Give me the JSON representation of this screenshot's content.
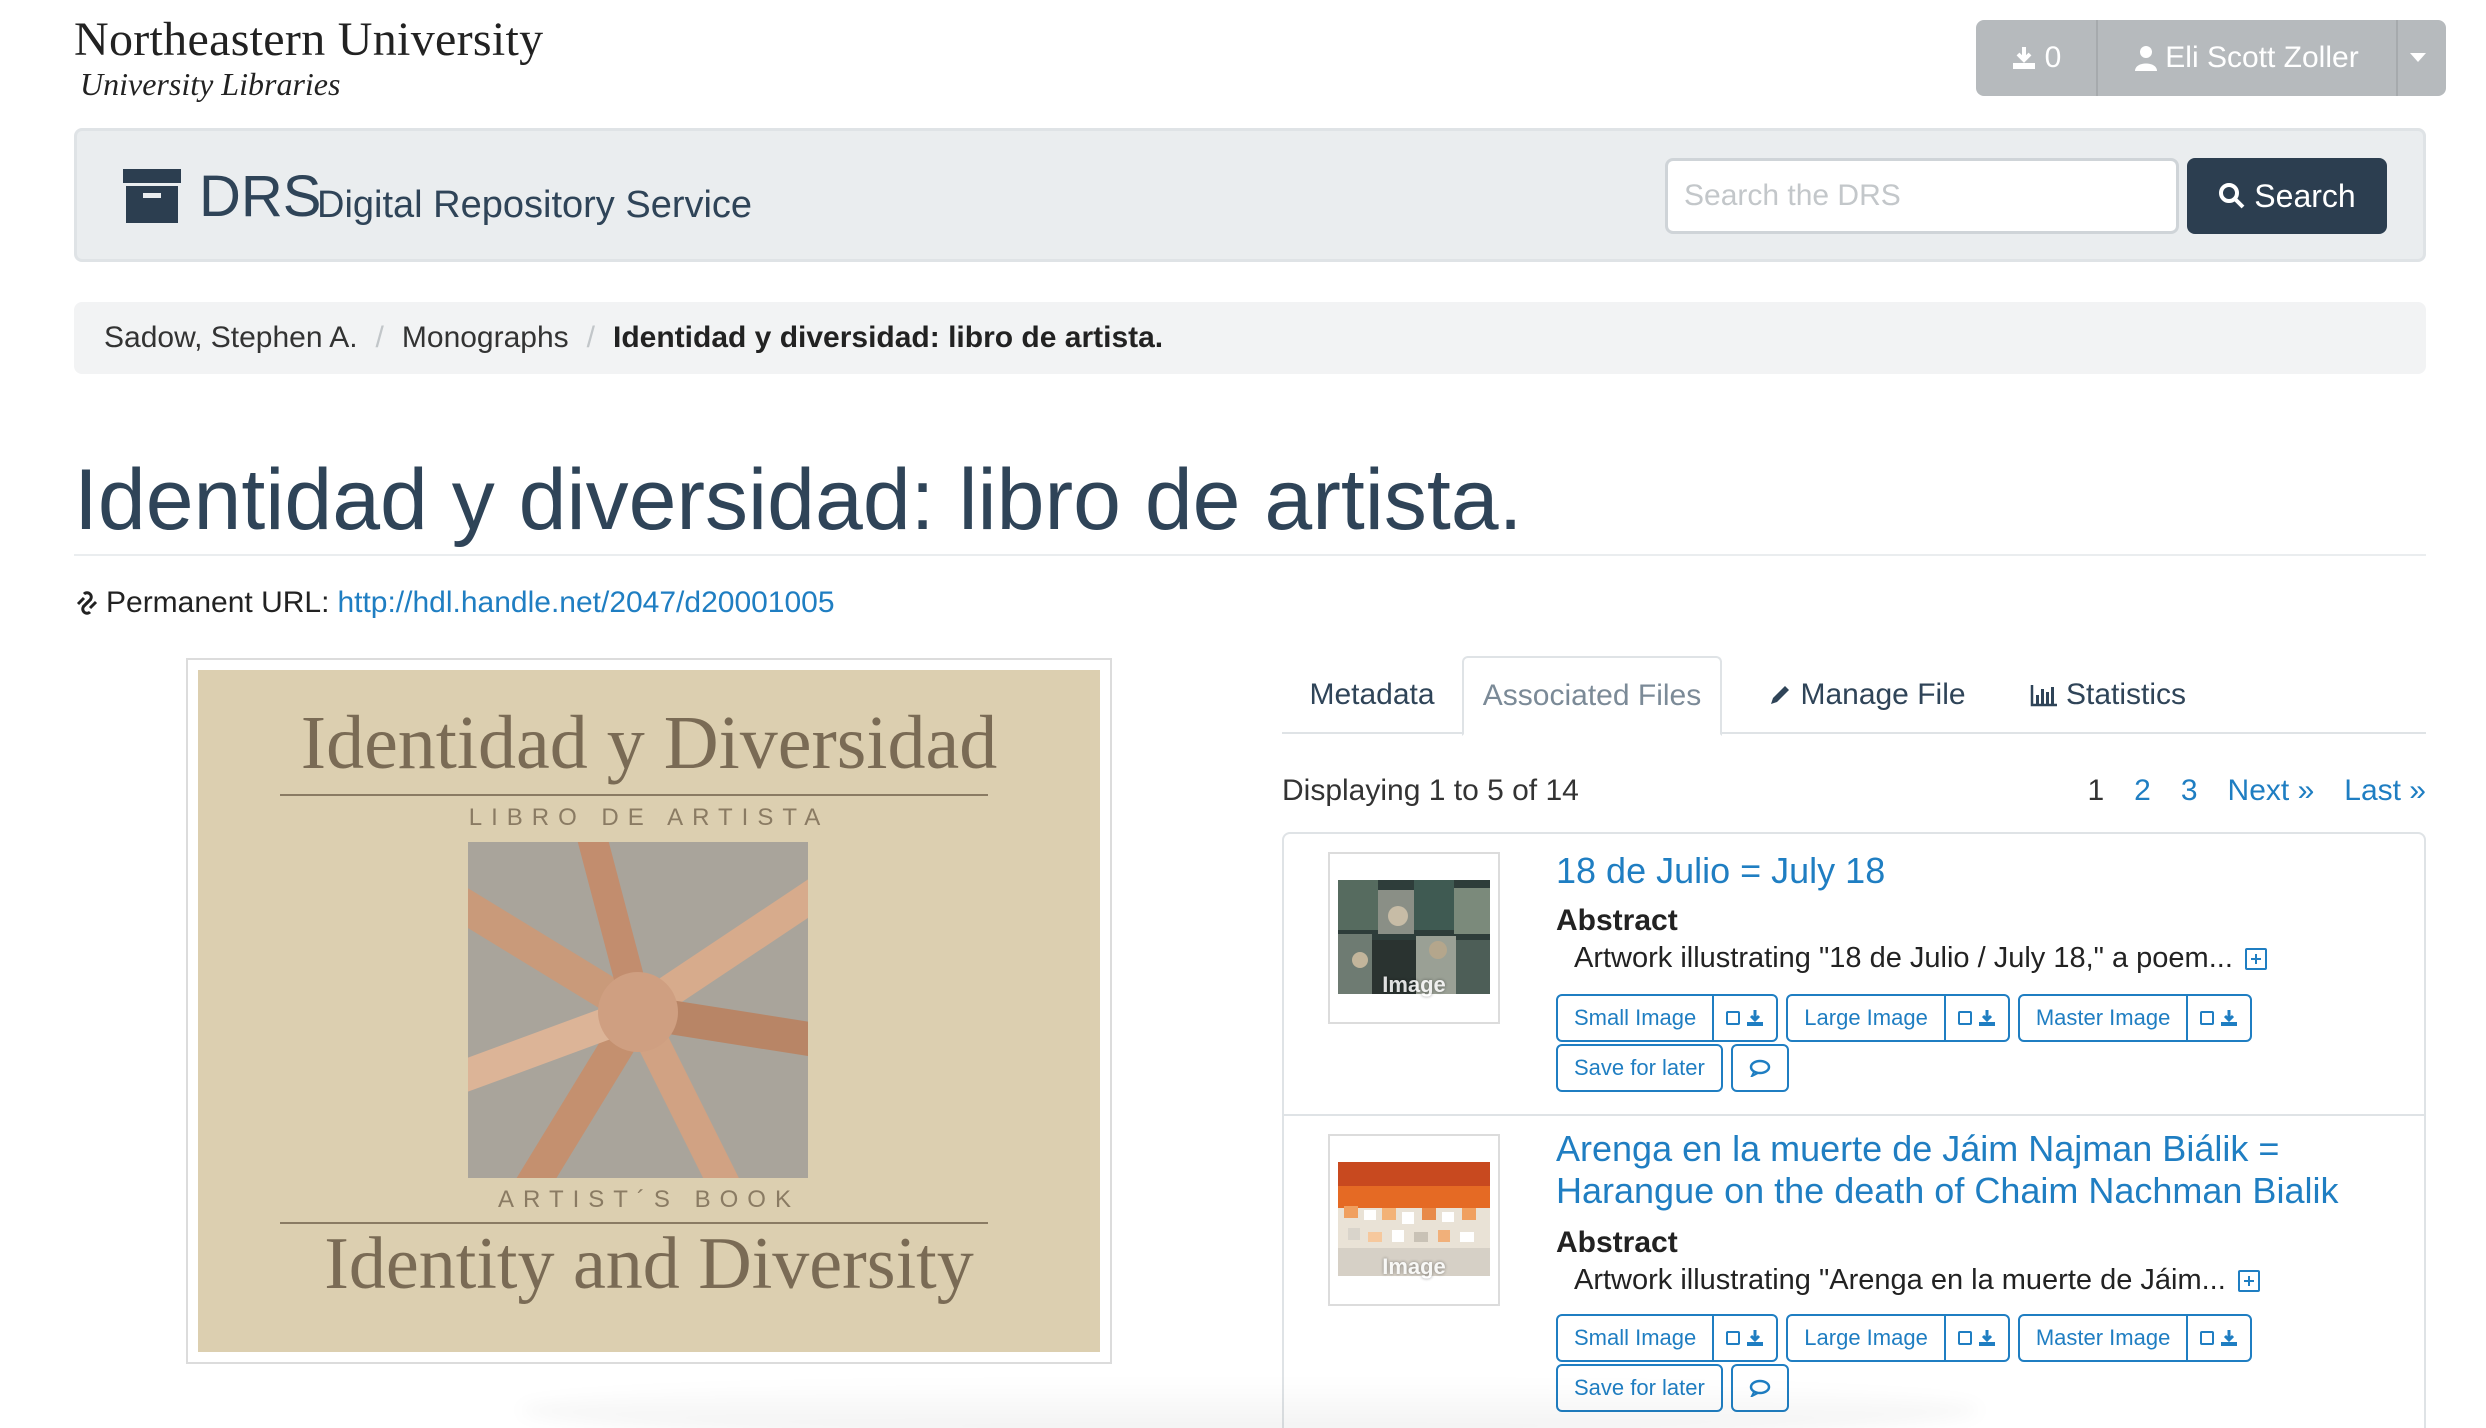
{
  "logo": {
    "line1": "Northeastern University",
    "line2": "University Libraries"
  },
  "user_menu": {
    "download_count": "0",
    "user_name": "Eli Scott Zoller"
  },
  "drs": {
    "acronym": "DRS",
    "full_name": "Digital Repository Service",
    "search_placeholder": "Search the DRS",
    "search_button": "Search"
  },
  "breadcrumb": {
    "items": [
      "Sadow, Stephen A.",
      "Monographs"
    ],
    "current": "Identidad y diversidad: libro de artista."
  },
  "page": {
    "title": "Identidad y diversidad: libro de artista.",
    "permanent_url_label": "Permanent URL:",
    "permanent_url": "http://hdl.handle.net/2047/d20001005"
  },
  "cover": {
    "title_es": "Identidad y Diversidad",
    "subtitle_es": "LIBRO DE ARTISTA",
    "subtitle_en": "ARTIST´S BOOK",
    "title_en": "Identity and Diversity"
  },
  "tabs": [
    {
      "label": "Metadata"
    },
    {
      "label": "Associated Files"
    },
    {
      "label": "Manage File"
    },
    {
      "label": "Statistics"
    }
  ],
  "listing": {
    "displaying": "Displaying 1 to 5 of 14",
    "pagination": {
      "current": "1",
      "pages": [
        "2",
        "3"
      ],
      "next": "Next »",
      "last": "Last »"
    }
  },
  "results": [
    {
      "title": "18 de Julio = July 18",
      "thumb_label": "Image",
      "abstract_label": "Abstract",
      "abstract": "Artwork illustrating \"18 de Julio / July 18,\" a poem...",
      "buttons": {
        "small": "Small Image",
        "large": "Large Image",
        "master": "Master Image",
        "save": "Save for later"
      }
    },
    {
      "title": "Arenga en la muerte de Jáim Najman Biálik = Harangue on the death of Chaim Nachman Bialik",
      "thumb_label": "Image",
      "abstract_label": "Abstract",
      "abstract": "Artwork illustrating \"Arenga en la muerte de Jáim...",
      "buttons": {
        "small": "Small Image",
        "large": "Large Image",
        "master": "Master Image",
        "save": "Save for later"
      }
    }
  ],
  "icons": {
    "download": "download-icon",
    "user": "user-icon",
    "caret": "caret-down-icon",
    "archive": "archive-box-icon",
    "search": "search-icon",
    "link": "link-icon",
    "pencil": "pencil-icon",
    "bar_chart": "bar-chart-icon",
    "checkbox": "checkbox-icon",
    "comment": "comment-icon",
    "expand": "plus-square-icon"
  },
  "colors": {
    "brand_dark": "#2c3e50",
    "link_blue": "#1f7ec2",
    "heading": "#2f4458",
    "user_button_gray": "#b6babd"
  }
}
